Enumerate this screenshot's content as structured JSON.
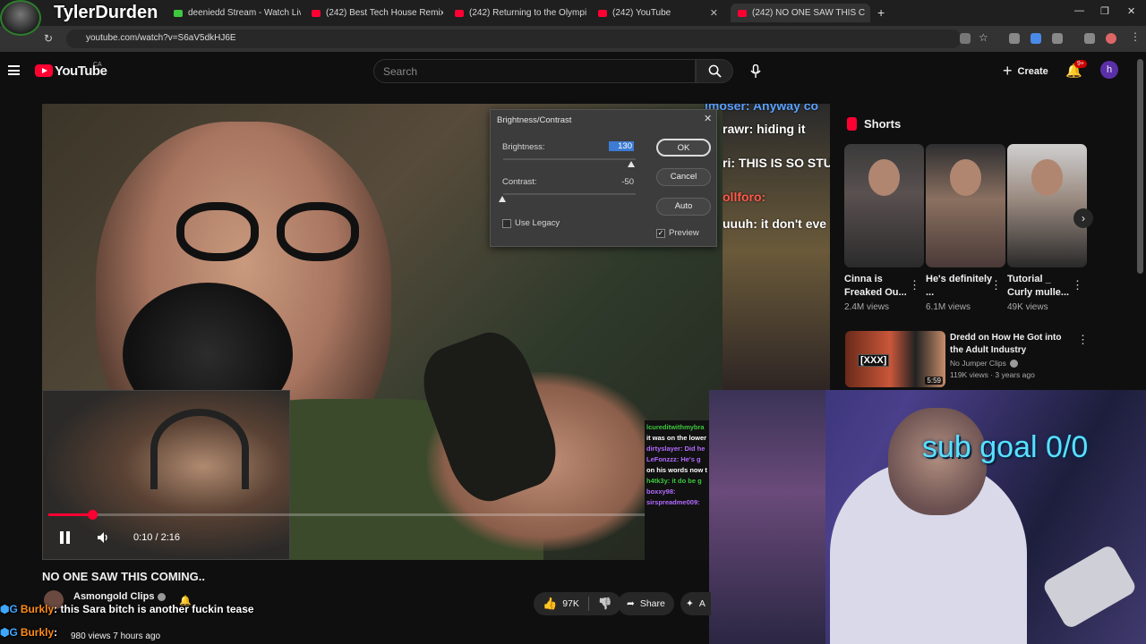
{
  "browser": {
    "tabs": [
      {
        "label": "deeniedd Stream - Watch Live ·"
      },
      {
        "label": "(242) Best Tech House Remixes"
      },
      {
        "label": "(242) Returning to the Olympia"
      },
      {
        "label": "(242) YouTube"
      },
      {
        "label": "(242) NO ONE SAW THIS C"
      }
    ],
    "url": "youtube.com/watch?v=S6aV5dkHJ6E",
    "new_tab": "+"
  },
  "stream_overlay": {
    "streamer_name": "TylerDurden",
    "sub_goal": "sub goal 0/0",
    "chat": [
      {
        "user": "Burkly",
        "text": ": this Sara bitch is another fuckin tease"
      },
      {
        "user": "Burkly",
        "text": ": "
      }
    ]
  },
  "youtube": {
    "logo_text": "YouTube",
    "region": "CA",
    "search_placeholder": "Search",
    "create_label": "Create",
    "notif_count": "9+",
    "avatar_letter": "h"
  },
  "video": {
    "time": "0:10 / 2:16",
    "progress": 0.074,
    "title": "NO ONE SAW THIS COMING..",
    "channel": "Asmongold Clips",
    "meta": "980 views  7 hours ago",
    "likes": "97K",
    "share_label": "Share",
    "extra_label": "A",
    "in_video_chat": [
      {
        "text": "lmoser: Anyway co"
      },
      {
        "text": "rawr: hiding it"
      },
      {
        "text": "ri: THIS IS SO STU"
      },
      {
        "text": "ollforo:"
      },
      {
        "text": "uuuh: it don't eve"
      }
    ],
    "mini_chat": [
      "lcureditwithmybra",
      "it was on the lower",
      "dirtyslayer: Did he",
      "LeFonzzz: He's g",
      "on his words now t",
      "h4tk3y: it do be g",
      "boxxy98:",
      "sirspreadme009:"
    ]
  },
  "photoshop_dialog": {
    "title": "Brightness/Contrast",
    "brightness_label": "Brightness:",
    "brightness_value": "130",
    "contrast_label": "Contrast:",
    "contrast_value": "-50",
    "use_legacy_label": "Use Legacy",
    "preview_label": "Preview",
    "ok_label": "OK",
    "cancel_label": "Cancel",
    "auto_label": "Auto"
  },
  "sidebar": {
    "shorts_heading": "Shorts",
    "shorts": [
      {
        "title": "Cinna is Freaked Ou...",
        "views": "2.4M views"
      },
      {
        "title": "He's definitely ...",
        "views": "6.1M views"
      },
      {
        "title": "Tutorial _ Curly mulle...",
        "views": "49K views"
      }
    ],
    "recommended": {
      "title": "Dredd on How He Got into the Adult Industry",
      "channel": "No Jumper Clips",
      "meta": "119K views · 3 years ago",
      "duration": "5:59",
      "thumb_tag": "[XXX]"
    }
  }
}
